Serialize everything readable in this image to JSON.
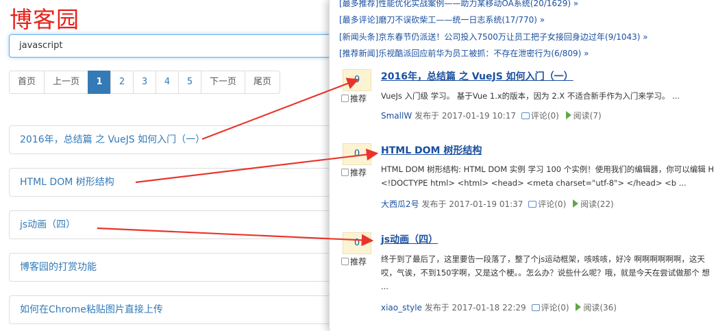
{
  "left": {
    "logo": "博客园",
    "search_value": "javascript",
    "pager": {
      "first": "首页",
      "prev": "上一页",
      "pages": [
        "1",
        "2",
        "3",
        "4",
        "5"
      ],
      "active_page": "1",
      "next": "下一页",
      "last": "尾页"
    },
    "results": [
      "2016年，总结篇 之 VueJS 如何入门（一）",
      "HTML DOM 树形结构",
      "js动画（四）",
      "博客园的打赏功能",
      "如何在Chrome粘贴图片直接上传"
    ]
  },
  "panel": {
    "top_links": [
      "[最多推荐]性能优化实战案例——助力某移动OA系统(20/1629) »",
      "[最多评论]磨刀不误砍柴工——统一日志系统(17/770) »",
      "[新闻头条]京东春节仍派送！公司投入7500万让员工把子女接回身边过年(9/1043) »",
      "[推荐新闻]乐视酷派回应前华为员工被抓：不存在泄密行为(6/809) »"
    ],
    "posts": [
      {
        "digg": "0",
        "recommend": "推荐",
        "title": "2016年，总结篇 之 VueJS 如何入门（一）",
        "summary": "VueJs 入门级 学习。 基于Vue 1.x的版本，因为 2.X 不适合新手作为入门来学习。 ...",
        "author": "SmallW",
        "published": "发布于 2017-01-19 10:17",
        "comments": "评论(0)",
        "reads": "阅读(7)"
      },
      {
        "digg": "0",
        "recommend": "推荐",
        "title": "HTML DOM 树形结构",
        "summary": "HTML DOM 树形结构: HTML DOM 实例 学习 100 个实例！使用我们的编辑器，你可以编辑 H <!DOCTYPE html> <html> <head> <meta charset=\"utf-8\"> </head> <b ...",
        "author": "大西瓜2号",
        "published": "发布于 2017-01-19 01:37",
        "comments": "评论(0)",
        "reads": "阅读(22)"
      },
      {
        "digg": "0",
        "recommend": "推荐",
        "title": "js动画（四）",
        "summary": "终于到了最后了，这里要告一段落了，整了个js运动框架，咳咳咳，好冷 啊啊啊啊啊啊，这天 哎，气诶，不到150字啊，又是这个梗。。怎么办？说些什么呢？哦，就是今天在尝试做那个 想 ...",
        "author": "xiao_style",
        "published": "发布于 2017-01-18 22:29",
        "comments": "评论(0)",
        "reads": "阅读(36)"
      }
    ]
  },
  "colors": {
    "logo": "#e8211a",
    "link": "#337ab7",
    "panel_link": "#1a4fa0",
    "arrow": "#e8352c",
    "active_page_bg": "#337ab7"
  }
}
